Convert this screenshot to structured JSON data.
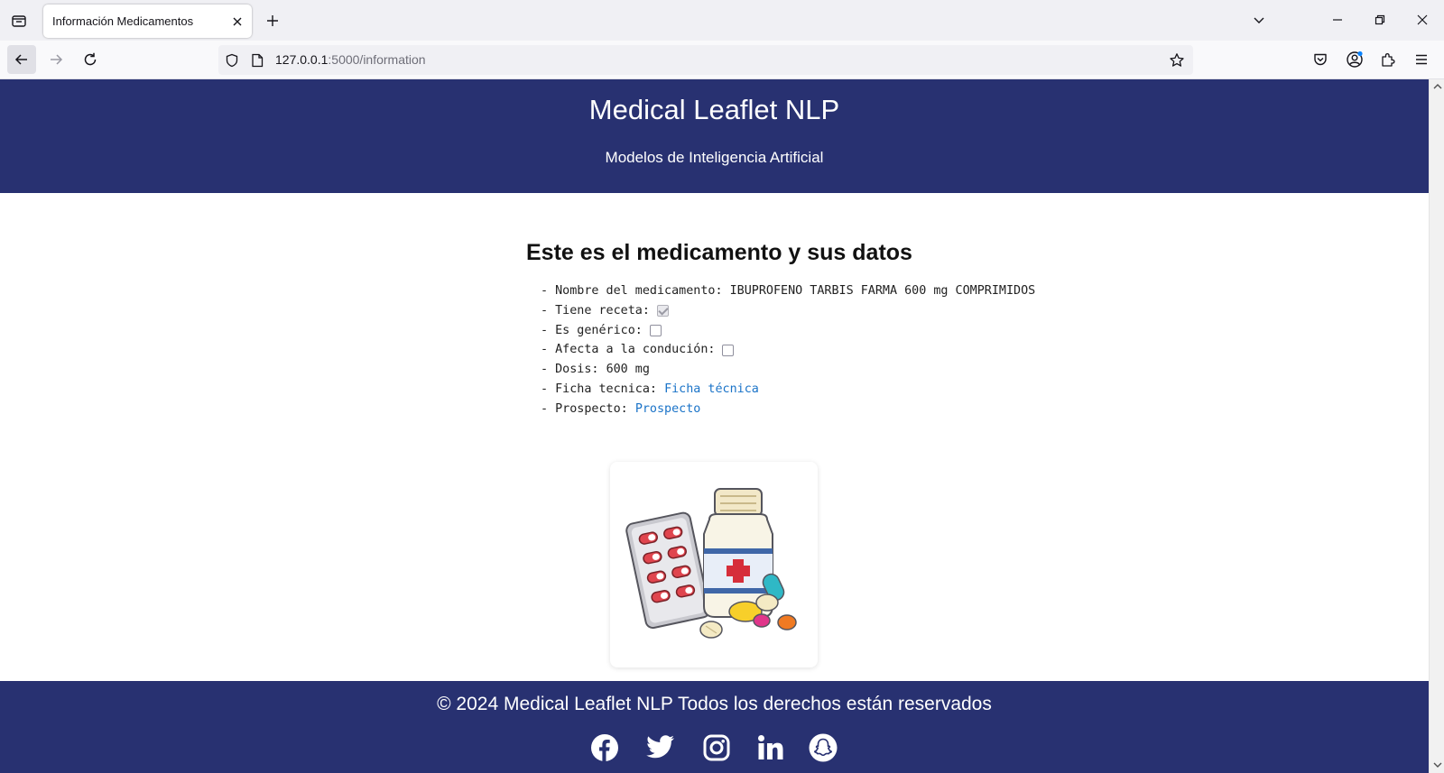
{
  "browser": {
    "tab_title": "Información Medicamentos",
    "url_host": "127.0.0.1",
    "url_rest": ":5000/information"
  },
  "header": {
    "title": "Medical Leaflet NLP",
    "subtitle": "Modelos de Inteligencia Artificial",
    "background": "#283171"
  },
  "main": {
    "title": "Este es el medicamento y sus datos",
    "details": {
      "name_label": "- Nombre del medicamento: ",
      "name_value": "IBUPROFENO TARBIS FARMA 600 mg COMPRIMIDOS",
      "prescription_label": "- Tiene receta:",
      "prescription_checked": true,
      "generic_label": "- Es genérico:",
      "generic_checked": false,
      "driving_label": "- Afecta a la condución:",
      "driving_checked": false,
      "dose_label": "- Dosis: ",
      "dose_value": "600 mg",
      "datasheet_label": "- Ficha tecnica: ",
      "datasheet_link": "Ficha técnica",
      "leaflet_label": "- Prospecto: ",
      "leaflet_link": "Prospecto"
    },
    "image_icon": "medicine-illustration"
  },
  "footer": {
    "copyright": "© 2024 Medical Leaflet NLP Todos los derechos están reservados",
    "social": [
      "facebook-icon",
      "twitter-icon",
      "instagram-icon",
      "linkedin-icon",
      "snapchat-icon"
    ]
  },
  "colors": {
    "brand": "#283171",
    "link": "#1a73c8"
  }
}
